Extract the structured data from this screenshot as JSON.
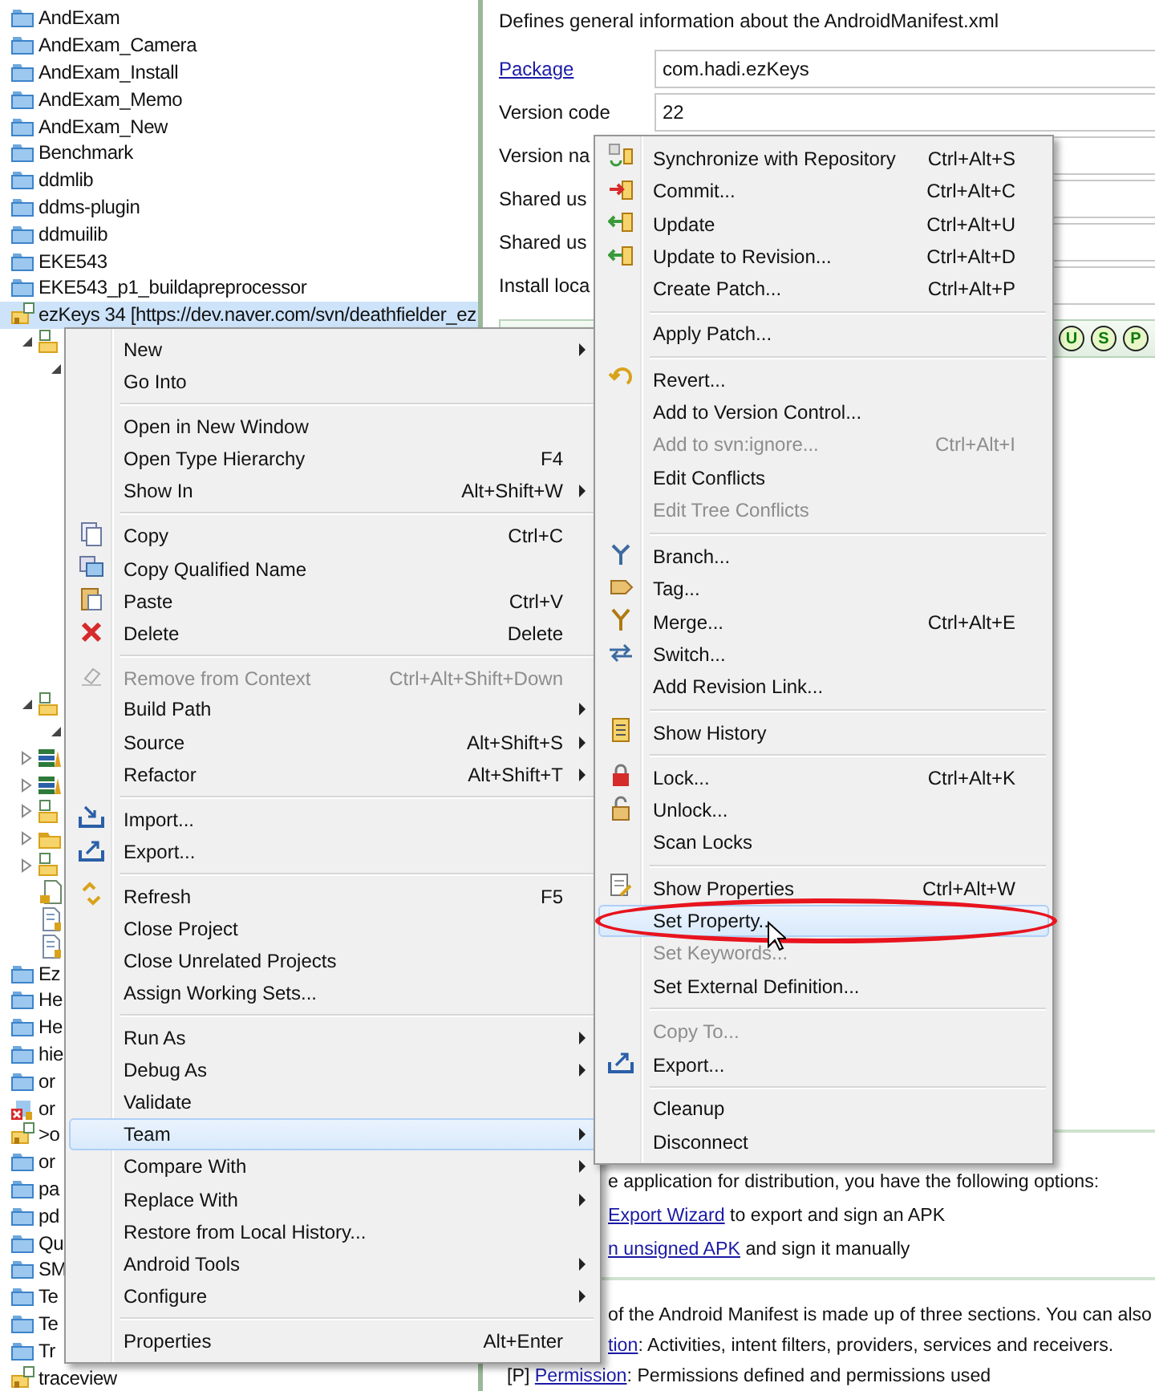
{
  "project_explorer": {
    "items": [
      {
        "label": "AndExam",
        "kind": "project",
        "selected": false
      },
      {
        "label": "AndExam_Camera",
        "kind": "project",
        "selected": false
      },
      {
        "label": "AndExam_Install",
        "kind": "project",
        "selected": false
      },
      {
        "label": "AndExam_Memo",
        "kind": "project",
        "selected": false
      },
      {
        "label": "AndExam_New",
        "kind": "project",
        "selected": false
      },
      {
        "label": "Benchmark",
        "kind": "project",
        "selected": false
      },
      {
        "label": "ddmlib",
        "kind": "project",
        "selected": false
      },
      {
        "label": "ddms-plugin",
        "kind": "project",
        "selected": false
      },
      {
        "label": "ddmuilib",
        "kind": "project",
        "selected": false
      },
      {
        "label": "EKE543",
        "kind": "project",
        "selected": false
      },
      {
        "label": "EKE543_p1_buildapreprocessor",
        "kind": "project",
        "selected": false
      },
      {
        "label": "ezKeys 34 [https://dev.naver.com/svn/deathfielder_ez",
        "kind": "svn_project",
        "selected": true,
        "children": [
          {
            "kind": "svn_folder",
            "expanded": true,
            "selected": false,
            "children": [
              {
                "expanded": true,
                "selected": false
              }
            ]
          },
          {
            "kind": "svn_folder",
            "expanded": true,
            "selected": false,
            "children": [
              {
                "expanded": true,
                "selected": false
              }
            ]
          },
          {
            "kind": "library",
            "expanded": false,
            "selected": false
          },
          {
            "kind": "library",
            "expanded": false,
            "selected": false
          },
          {
            "kind": "svn_folder",
            "expanded": false,
            "selected": false
          },
          {
            "kind": "folder",
            "expanded": false,
            "selected": false
          },
          {
            "kind": "svn_folder",
            "expanded": false,
            "selected": false
          },
          {
            "kind": "svn_file",
            "selected": false
          },
          {
            "kind": "file",
            "selected": false
          },
          {
            "kind": "file",
            "selected": false
          }
        ]
      },
      {
        "label": "Ez",
        "kind": "project",
        "selected": false
      },
      {
        "label": "He",
        "kind": "project",
        "selected": false
      },
      {
        "label": "He",
        "kind": "project",
        "selected": false
      },
      {
        "label": "hie",
        "kind": "project",
        "selected": false
      },
      {
        "label": "or",
        "kind": "project",
        "selected": false
      },
      {
        "label": "or",
        "kind": "error_project",
        "selected": false
      },
      {
        "label": ">o",
        "kind": "svn_project",
        "selected": false
      },
      {
        "label": "or",
        "kind": "project",
        "selected": false
      },
      {
        "label": "pa",
        "kind": "project",
        "selected": false
      },
      {
        "label": "pd",
        "kind": "project",
        "selected": false
      },
      {
        "label": "Qu",
        "kind": "project",
        "selected": false
      },
      {
        "label": "SM",
        "kind": "project",
        "selected": false
      },
      {
        "label": "Te",
        "kind": "project",
        "selected": false
      },
      {
        "label": "Te",
        "kind": "project",
        "selected": false
      },
      {
        "label": "Tr",
        "kind": "project",
        "selected": false
      },
      {
        "label": "traceview",
        "kind": "svn_project",
        "selected": false
      }
    ]
  },
  "manifest_editor": {
    "description": "Defines general information about the AndroidManifest.xml",
    "fields": [
      {
        "label": "Package",
        "kind": "link",
        "value": "com.hadi.ezKeys"
      },
      {
        "label": "Version code",
        "kind": "text",
        "value": "22"
      },
      {
        "label": "Version na",
        "kind": "text"
      },
      {
        "label": "Shared us",
        "kind": "text"
      },
      {
        "label": "Shared us",
        "kind": "text"
      },
      {
        "label": "Install loca",
        "kind": "text"
      }
    ],
    "status_icons": [
      "U",
      "S",
      "P"
    ],
    "exporting_lines": [
      [
        {
          "text": "e application for distribution, you have the following options:"
        }
      ],
      [
        {
          "text": "Export Wizard",
          "link": true
        },
        {
          "text": " to export and sign an APK"
        }
      ],
      [
        {
          "text": "n unsigned APK",
          "link": true
        },
        {
          "text": " and sign it manually"
        }
      ]
    ],
    "manifest_lines": [
      [
        {
          "text": " of the Android Manifest is made up of three sections. You can also"
        }
      ],
      [
        {
          "text": "tion",
          "link": true
        },
        {
          "text": ": Activities, intent filters, providers, services and receivers."
        }
      ]
    ],
    "permissions_line": [
      {
        "text": "[P] "
      },
      {
        "text": "Permission",
        "link": true
      },
      {
        "text": ": Permissions defined and permissions used"
      }
    ]
  },
  "context_menu": {
    "items": [
      {
        "kind": "item",
        "label": "New",
        "submenu": true,
        "disabled": false,
        "selected": false
      },
      {
        "kind": "item",
        "label": "Go Into",
        "submenu": false,
        "disabled": false,
        "selected": false
      },
      {
        "kind": "separator"
      },
      {
        "kind": "item",
        "label": "Open in New Window",
        "submenu": false,
        "disabled": false,
        "selected": false
      },
      {
        "kind": "item",
        "label": "Open Type Hierarchy",
        "shortcut": "F4",
        "submenu": false,
        "disabled": false,
        "selected": false
      },
      {
        "kind": "item",
        "label": "Show In",
        "shortcut": "Alt+Shift+W",
        "submenu": true,
        "disabled": false,
        "selected": false
      },
      {
        "kind": "separator"
      },
      {
        "kind": "copy",
        "label": "Copy",
        "shortcut": "Ctrl+C",
        "submenu": false,
        "disabled": false,
        "selected": false
      },
      {
        "kind": "copy2",
        "label": "Copy Qualified Name",
        "submenu": false,
        "disabled": false,
        "selected": false
      },
      {
        "kind": "paste",
        "label": "Paste",
        "shortcut": "Ctrl+V",
        "submenu": false,
        "disabled": false,
        "selected": false
      },
      {
        "kind": "delete",
        "label": "Delete",
        "shortcut": "Delete",
        "submenu": false,
        "disabled": false,
        "selected": false
      },
      {
        "kind": "separator"
      },
      {
        "kind": "remove",
        "label": "Remove from Context",
        "shortcut": "Ctrl+Alt+Shift+Down",
        "submenu": false,
        "disabled": true,
        "selected": false
      },
      {
        "kind": "item",
        "label": "Build Path",
        "submenu": true,
        "disabled": false,
        "selected": false
      },
      {
        "kind": "item",
        "label": "Source",
        "shortcut": "Alt+Shift+S",
        "submenu": true,
        "disabled": false,
        "selected": false
      },
      {
        "kind": "item",
        "label": "Refactor",
        "shortcut": "Alt+Shift+T",
        "submenu": true,
        "disabled": false,
        "selected": false
      },
      {
        "kind": "separator"
      },
      {
        "kind": "import",
        "label": "Import...",
        "submenu": false,
        "disabled": false,
        "selected": false
      },
      {
        "kind": "export",
        "label": "Export...",
        "submenu": false,
        "disabled": false,
        "selected": false
      },
      {
        "kind": "separator"
      },
      {
        "kind": "refresh",
        "label": "Refresh",
        "shortcut": "F5",
        "submenu": false,
        "disabled": false,
        "selected": false
      },
      {
        "kind": "item",
        "label": "Close Project",
        "submenu": false,
        "disabled": false,
        "selected": false
      },
      {
        "kind": "item",
        "label": "Close Unrelated Projects",
        "submenu": false,
        "disabled": false,
        "selected": false
      },
      {
        "kind": "item",
        "label": "Assign Working Sets...",
        "submenu": false,
        "disabled": false,
        "selected": false
      },
      {
        "kind": "separator"
      },
      {
        "kind": "item",
        "label": "Run As",
        "submenu": true,
        "disabled": false,
        "selected": false
      },
      {
        "kind": "item",
        "label": "Debug As",
        "submenu": true,
        "disabled": false,
        "selected": false
      },
      {
        "kind": "item",
        "label": "Validate",
        "submenu": false,
        "disabled": false,
        "selected": false
      },
      {
        "kind": "item",
        "label": "Team",
        "submenu": true,
        "disabled": false,
        "selected": true
      },
      {
        "kind": "item",
        "label": "Compare With",
        "submenu": true,
        "disabled": false,
        "selected": false
      },
      {
        "kind": "item",
        "label": "Replace With",
        "submenu": true,
        "disabled": false,
        "selected": false
      },
      {
        "kind": "item",
        "label": "Restore from Local History...",
        "submenu": false,
        "disabled": false,
        "selected": false
      },
      {
        "kind": "item",
        "label": "Android Tools",
        "submenu": true,
        "disabled": false,
        "selected": false
      },
      {
        "kind": "item",
        "label": "Configure",
        "submenu": true,
        "disabled": false,
        "selected": false
      },
      {
        "kind": "separator"
      },
      {
        "kind": "item",
        "label": "Properties",
        "shortcut": "Alt+Enter",
        "submenu": false,
        "disabled": false,
        "selected": false
      }
    ]
  },
  "team_submenu": {
    "items": [
      {
        "kind": "sync",
        "label": "Synchronize with Repository",
        "shortcut": "Ctrl+Alt+S",
        "disabled": false,
        "selected": false,
        "circled": false
      },
      {
        "kind": "commit",
        "label": "Commit...",
        "shortcut": "Ctrl+Alt+C",
        "disabled": false,
        "selected": false,
        "circled": false
      },
      {
        "kind": "update",
        "label": "Update",
        "shortcut": "Ctrl+Alt+U",
        "disabled": false,
        "selected": false,
        "circled": false
      },
      {
        "kind": "update",
        "label": "Update to Revision...",
        "shortcut": "Ctrl+Alt+D",
        "disabled": false,
        "selected": false,
        "circled": false
      },
      {
        "kind": "item",
        "label": "Create Patch...",
        "shortcut": "Ctrl+Alt+P",
        "disabled": false,
        "selected": false,
        "circled": false
      },
      {
        "kind": "separator"
      },
      {
        "kind": "item",
        "label": "Apply Patch...",
        "disabled": false,
        "selected": false,
        "circled": false
      },
      {
        "kind": "separator"
      },
      {
        "kind": "revert",
        "label": "Revert...",
        "disabled": false,
        "selected": false,
        "circled": false
      },
      {
        "kind": "item",
        "label": "Add to Version Control...",
        "disabled": false,
        "selected": false,
        "circled": false
      },
      {
        "kind": "item",
        "label": "Add to svn:ignore...",
        "shortcut": "Ctrl+Alt+I",
        "disabled": true,
        "selected": false,
        "circled": false
      },
      {
        "kind": "item",
        "label": "Edit Conflicts",
        "disabled": false,
        "selected": false,
        "circled": false
      },
      {
        "kind": "item",
        "label": "Edit Tree Conflicts",
        "disabled": true,
        "selected": false,
        "circled": false
      },
      {
        "kind": "separator"
      },
      {
        "kind": "branch",
        "label": "Branch...",
        "disabled": false,
        "selected": false,
        "circled": false
      },
      {
        "kind": "tag",
        "label": "Tag...",
        "disabled": false,
        "selected": false,
        "circled": false
      },
      {
        "kind": "merge",
        "label": "Merge...",
        "shortcut": "Ctrl+Alt+E",
        "disabled": false,
        "selected": false,
        "circled": false
      },
      {
        "kind": "switch",
        "label": "Switch...",
        "disabled": false,
        "selected": false,
        "circled": false
      },
      {
        "kind": "item",
        "label": "Add Revision Link...",
        "disabled": false,
        "selected": false,
        "circled": false
      },
      {
        "kind": "separator"
      },
      {
        "kind": "history",
        "label": "Show History",
        "disabled": false,
        "selected": false,
        "circled": false
      },
      {
        "kind": "separator"
      },
      {
        "kind": "lock",
        "label": "Lock...",
        "shortcut": "Ctrl+Alt+K",
        "disabled": false,
        "selected": false,
        "circled": false
      },
      {
        "kind": "unlock",
        "label": "Unlock...",
        "disabled": false,
        "selected": false,
        "circled": false
      },
      {
        "kind": "item",
        "label": "Scan Locks",
        "disabled": false,
        "selected": false,
        "circled": false
      },
      {
        "kind": "separator"
      },
      {
        "kind": "properties",
        "label": "Show Properties",
        "shortcut": "Ctrl+Alt+W",
        "disabled": false,
        "selected": false,
        "circled": false
      },
      {
        "kind": "item",
        "label": "Set Property...",
        "disabled": false,
        "selected": true,
        "circled": true
      },
      {
        "kind": "item",
        "label": "Set Keywords...",
        "disabled": true,
        "selected": false,
        "circled": false
      },
      {
        "kind": "item",
        "label": "Set External Definition...",
        "disabled": false,
        "selected": false,
        "circled": false
      },
      {
        "kind": "separator"
      },
      {
        "kind": "item",
        "label": "Copy To...",
        "disabled": true,
        "selected": false,
        "circled": false
      },
      {
        "kind": "export",
        "label": "Export...",
        "disabled": false,
        "selected": false,
        "circled": false
      },
      {
        "kind": "separator"
      },
      {
        "kind": "item",
        "label": "Cleanup",
        "disabled": false,
        "selected": false,
        "circled": false
      },
      {
        "kind": "item",
        "label": "Disconnect",
        "disabled": false,
        "selected": false,
        "circled": false
      }
    ]
  }
}
